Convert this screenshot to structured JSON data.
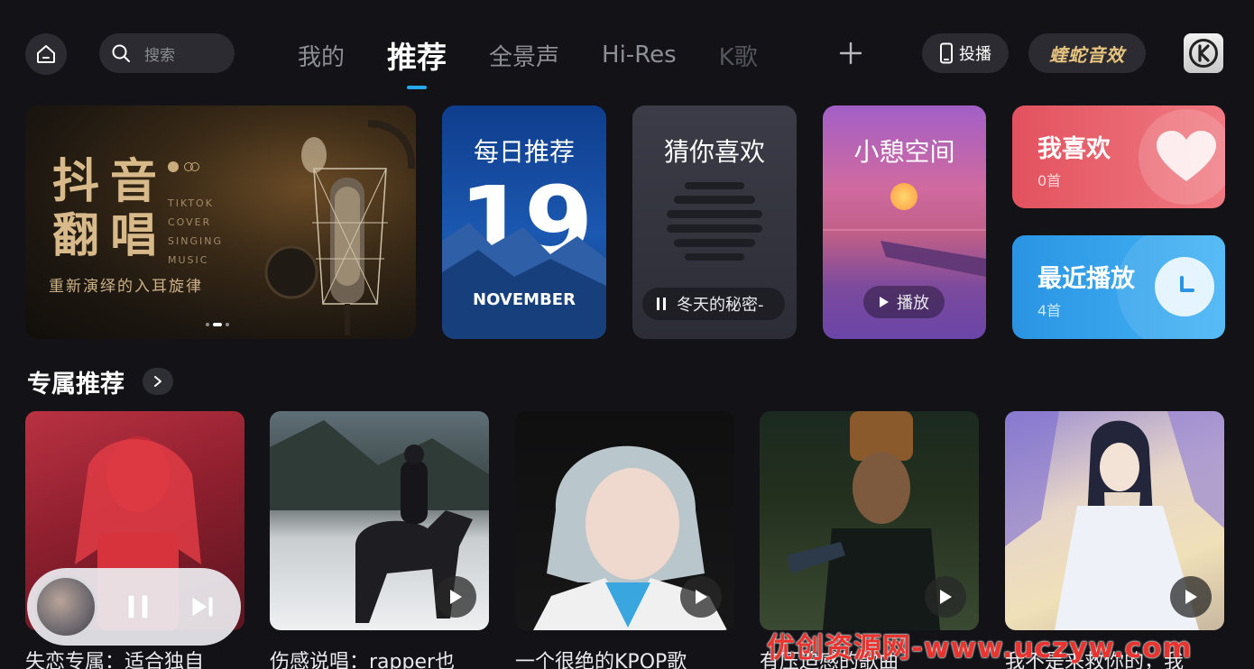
{
  "search": {
    "placeholder": "搜索"
  },
  "tabs": [
    {
      "label": "我的"
    },
    {
      "label": "推荐"
    },
    {
      "label": "全景声"
    },
    {
      "label": "Hi-Res"
    },
    {
      "label": "K歌"
    }
  ],
  "header": {
    "cast_label": "投播",
    "viper_label": "蝰蛇音效"
  },
  "banner": {
    "title_line1": "抖音",
    "title_line2": "翻唱",
    "english": [
      "TIKTOK",
      "COVER",
      "SINGING",
      "MUSIC"
    ],
    "subtitle": "重新演绎的入耳旋律"
  },
  "daily": {
    "title": "每日推荐",
    "day": "19",
    "month": "NOVEMBER"
  },
  "guess": {
    "title": "猜你喜欢",
    "now_playing": "冬天的秘密-"
  },
  "relax": {
    "title": "小憩空间",
    "play_label": "播放"
  },
  "liked": {
    "title": "我喜欢",
    "count": "0首"
  },
  "recent": {
    "title": "最近播放",
    "count": "4首"
  },
  "section": {
    "title": "专属推荐"
  },
  "tiles": [
    {
      "caption": "失恋专属：适合独自"
    },
    {
      "caption": "伤感说唱：rapper也"
    },
    {
      "caption": "一个很绝的KPOP歌"
    },
    {
      "caption": "有压迫感的歌曲"
    },
    {
      "caption": "我不是来救你的，我"
    }
  ],
  "watermark": "优创资源网-www.uczyw.com",
  "colors": {
    "accent": "#25a8f0",
    "liked": "#e2525e",
    "recent": "#2a94e3",
    "background": "#121217"
  }
}
